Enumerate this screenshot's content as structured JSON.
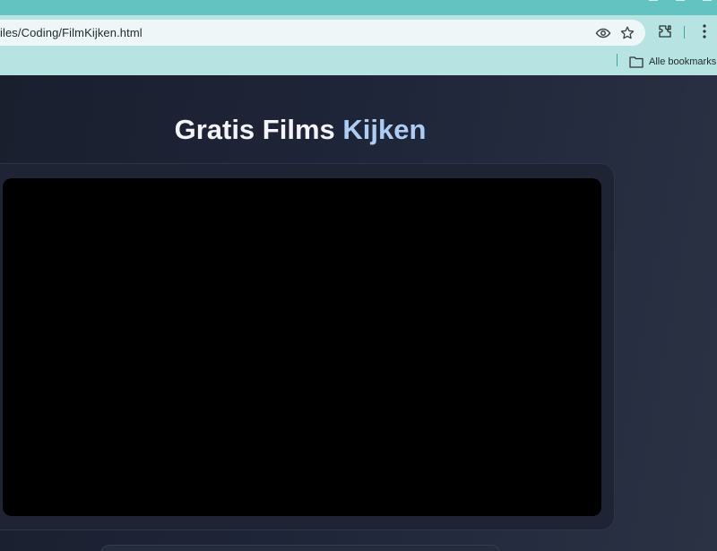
{
  "browser": {
    "url": "iles/Coding/FilmKijken.html",
    "bookmarks_label": "Alle bookmarks",
    "icons": [
      "eye-icon",
      "star-icon",
      "extensions-icon",
      "menu-icon",
      "folder-icon"
    ]
  },
  "page": {
    "title_part1": "Gratis Films ",
    "title_part2": "Kijken"
  },
  "colors": {
    "title_strip": "#63c3c1",
    "toolbar": "#b7e3e2",
    "page_background": "#1f2538",
    "title_accent": "#aecdf5",
    "video": "#000000"
  }
}
